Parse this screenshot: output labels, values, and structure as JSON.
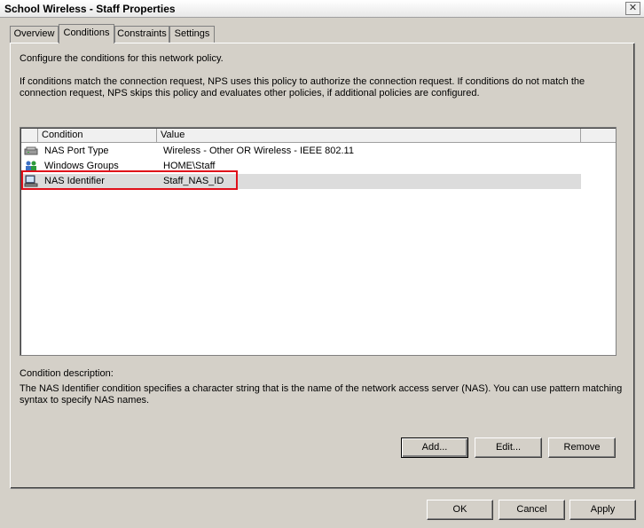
{
  "window": {
    "title": "School Wireless - Staff Properties",
    "close_glyph": "✕"
  },
  "tabs": [
    {
      "label": "Overview",
      "active": false
    },
    {
      "label": "Conditions",
      "active": true
    },
    {
      "label": "Constraints",
      "active": false
    },
    {
      "label": "Settings",
      "active": false
    }
  ],
  "intro": {
    "line1": "Configure the conditions for this network policy.",
    "para_line1": "If conditions match the connection request, NPS uses this policy to authorize the connection request. If conditions do not match the",
    "para_line2": "connection request, NPS skips this policy and evaluates other policies, if additional policies are configured."
  },
  "conditions_table": {
    "columns": [
      "Condition",
      "Value"
    ],
    "rows": [
      {
        "icon": "nas-port-type-icon",
        "condition": "NAS Port Type",
        "value": "Wireless - Other OR Wireless - IEEE 802.11",
        "selected": false
      },
      {
        "icon": "windows-groups-icon",
        "condition": "Windows Groups",
        "value": "HOME\\Staff",
        "selected": false
      },
      {
        "icon": "nas-identifier-icon",
        "condition": "NAS Identifier",
        "value": "Staff_NAS_ID",
        "selected": true
      }
    ]
  },
  "description": {
    "label": "Condition description:",
    "line1": "The NAS Identifier condition specifies a character string that is the name of the network access server (NAS). You can use pattern matching",
    "line2": "syntax to specify NAS names."
  },
  "actions": {
    "add": "Add...",
    "edit": "Edit...",
    "remove": "Remove"
  },
  "footer": {
    "ok": "OK",
    "cancel": "Cancel",
    "apply": "Apply"
  },
  "colors": {
    "highlight_border": "#e0101a",
    "dialog_background": "#d4d0c8"
  }
}
